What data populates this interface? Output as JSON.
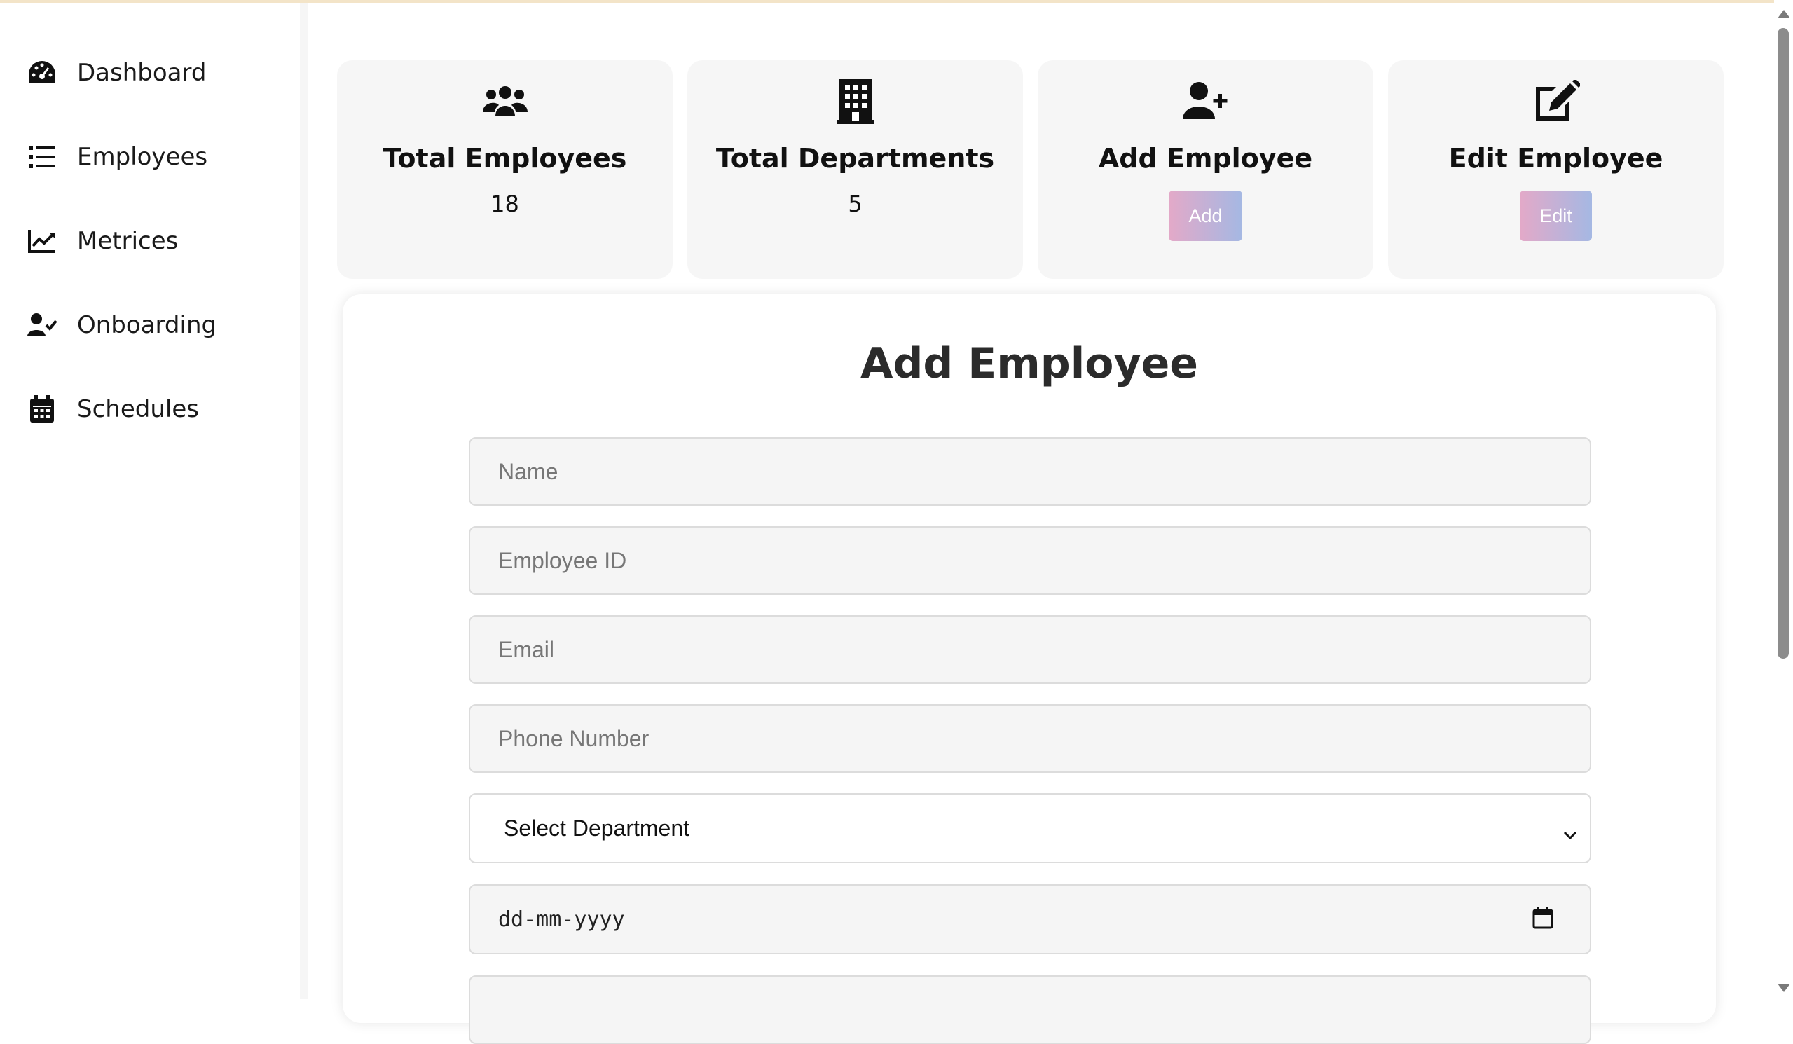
{
  "sidebar": {
    "items": [
      {
        "label": "Dashboard",
        "icon": "gauge-icon"
      },
      {
        "label": "Employees",
        "icon": "list-icon"
      },
      {
        "label": "Metrices",
        "icon": "chart-line-icon"
      },
      {
        "label": "Onboarding",
        "icon": "user-check-icon"
      },
      {
        "label": "Schedules",
        "icon": "calendar-icon"
      }
    ]
  },
  "cards": [
    {
      "title": "Total Employees",
      "value": "18",
      "icon": "users-icon"
    },
    {
      "title": "Total Departments",
      "value": "5",
      "icon": "building-icon"
    },
    {
      "title": "Add Employee",
      "button": "Add",
      "icon": "user-plus-icon"
    },
    {
      "title": "Edit Employee",
      "button": "Edit",
      "icon": "edit-icon"
    }
  ],
  "form": {
    "title": "Add Employee",
    "name_placeholder": "Name",
    "employee_id_placeholder": "Employee ID",
    "email_placeholder": "Email",
    "phone_placeholder": "Phone Number",
    "department_select": "Select Department",
    "date_placeholder": "dd-mm-yyyy"
  },
  "colors": {
    "button_gradient_start": "#e3a9c8",
    "button_gradient_end": "#a5b8e3",
    "card_background": "#f6f6f6"
  }
}
